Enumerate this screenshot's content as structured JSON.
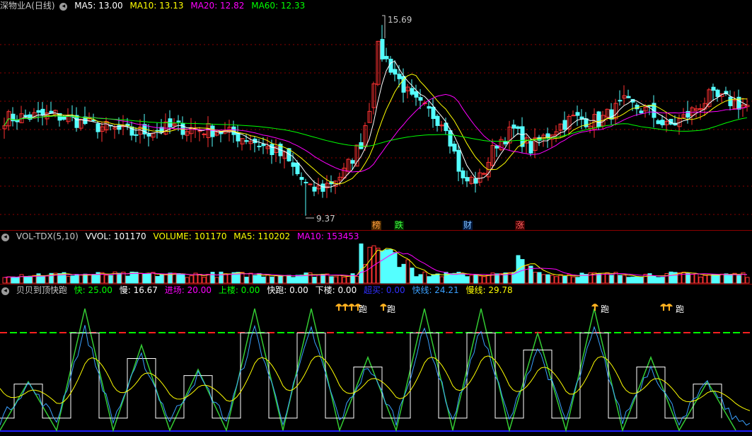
{
  "price": {
    "title": "深物业A(日线)",
    "indicators": [
      {
        "label": "MA5: 13.00",
        "color": "#ffffff"
      },
      {
        "label": "MA10: 13.13",
        "color": "#ffff00"
      },
      {
        "label": "MA20: 12.82",
        "color": "#ff00ff"
      },
      {
        "label": "MA60: 12.33",
        "color": "#00ff00"
      }
    ],
    "high_label": "15.69",
    "low_label": "9.37",
    "badges": [
      {
        "text": "榜",
        "color": "#ffa040",
        "bg": "#4a2a00"
      },
      {
        "text": "跌",
        "color": "#40ff40",
        "bg": "#003000"
      },
      {
        "text": "财",
        "color": "#80c0ff",
        "bg": "#001a40"
      },
      {
        "text": "涨",
        "color": "#ff6060",
        "bg": "#400000"
      }
    ],
    "colors": {
      "up": "#ff3232",
      "down": "#54ffff",
      "grid": "#8b0000"
    }
  },
  "volume": {
    "title": "VOL-TDX(5,10)",
    "indicators": [
      {
        "label": "VVOL: 101170",
        "color": "#ffffff"
      },
      {
        "label": "VOLUME: 101170",
        "color": "#ffff00"
      },
      {
        "label": "MA5: 110202",
        "color": "#ffff00"
      },
      {
        "label": "MA10: 153453",
        "color": "#ff00ff"
      }
    ]
  },
  "indicator": {
    "title": "贝贝到顶快跑",
    "indicators": [
      {
        "label": "快: 25.00",
        "color": "#00ff00"
      },
      {
        "label": "慢: 16.67",
        "color": "#ffffff"
      },
      {
        "label": "进场: 20.00",
        "color": "#ff00ff"
      },
      {
        "label": "上楼: 0.00",
        "color": "#00ff00"
      },
      {
        "label": "快跑: 0.00",
        "color": "#ffffff"
      },
      {
        "label": "下楼: 0.00",
        "color": "#ffffff"
      },
      {
        "label": "超买: 0.00",
        "color": "#3030ff"
      },
      {
        "label": "快线: 24.21",
        "color": "#3aa0ff"
      },
      {
        "label": "慢线: 29.78",
        "color": "#ffff00"
      }
    ],
    "signal_text": "跑"
  }
}
